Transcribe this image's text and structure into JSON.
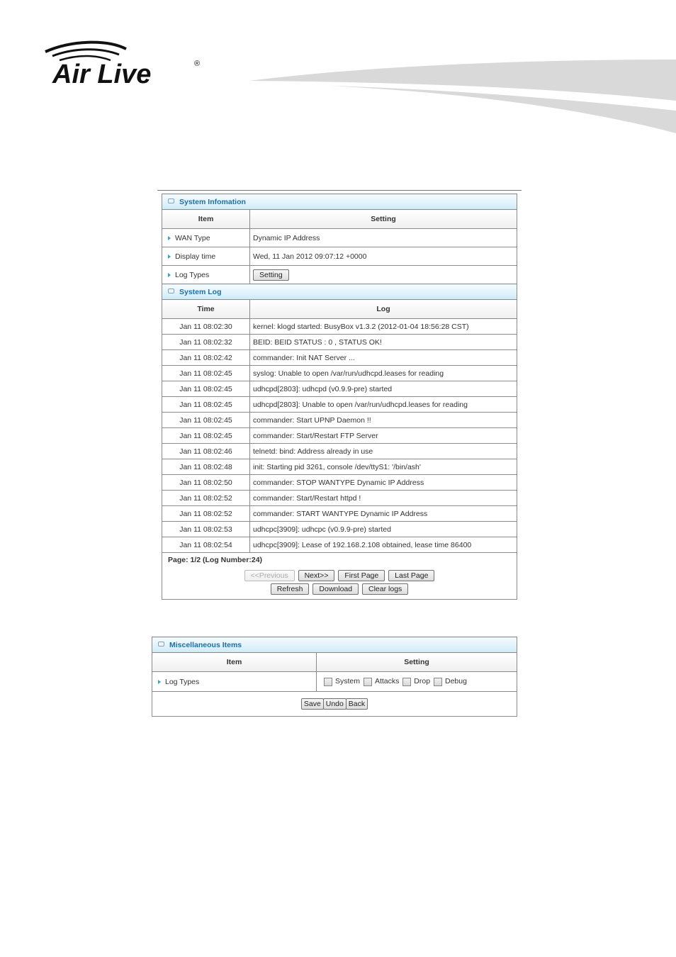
{
  "brand": {
    "name": "Air Live",
    "registered_mark": "®"
  },
  "system_info": {
    "title": "System Infomation",
    "columns": [
      "Item",
      "Setting"
    ],
    "rows": [
      {
        "label": "WAN Type",
        "value": "Dynamic IP Address"
      },
      {
        "label": "Display time",
        "value": "Wed, 11 Jan 2012 09:07:12 +0000"
      },
      {
        "label": "Log Types",
        "button": "Setting"
      }
    ]
  },
  "system_log": {
    "title": "System Log",
    "columns": [
      "Time",
      "Log"
    ],
    "rows": [
      {
        "time": "Jan 11 08:02:30",
        "log": "kernel: klogd started: BusyBox v1.3.2 (2012-01-04 18:56:28 CST)"
      },
      {
        "time": "Jan 11 08:02:32",
        "log": "BEID: BEID STATUS : 0 , STATUS OK!"
      },
      {
        "time": "Jan 11 08:02:42",
        "log": "commander: Init NAT Server ..."
      },
      {
        "time": "Jan 11 08:02:45",
        "log": "syslog: Unable to open /var/run/udhcpd.leases for reading"
      },
      {
        "time": "Jan 11 08:02:45",
        "log": "udhcpd[2803]: udhcpd (v0.9.9-pre) started"
      },
      {
        "time": "Jan 11 08:02:45",
        "log": "udhcpd[2803]: Unable to open /var/run/udhcpd.leases for reading"
      },
      {
        "time": "Jan 11 08:02:45",
        "log": "commander: Start UPNP Daemon !!"
      },
      {
        "time": "Jan 11 08:02:45",
        "log": "commander: Start/Restart FTP Server"
      },
      {
        "time": "Jan 11 08:02:46",
        "log": "telnetd: bind: Address already in use"
      },
      {
        "time": "Jan 11 08:02:48",
        "log": "init: Starting pid 3261, console /dev/ttyS1: '/bin/ash'"
      },
      {
        "time": "Jan 11 08:02:50",
        "log": "commander: STOP WANTYPE Dynamic IP Address"
      },
      {
        "time": "Jan 11 08:02:52",
        "log": "commander: Start/Restart httpd !"
      },
      {
        "time": "Jan 11 08:02:52",
        "log": "commander: START WANTYPE Dynamic IP Address"
      },
      {
        "time": "Jan 11 08:02:53",
        "log": "udhcpc[3909]: udhcpc (v0.9.9-pre) started"
      },
      {
        "time": "Jan 11 08:02:54",
        "log": "udhcpc[3909]: Lease of 192.168.2.108 obtained, lease time 86400"
      }
    ],
    "page_info": "Page: 1/2 (Log Number:24)",
    "nav_buttons": {
      "previous": "<<Previous",
      "next": "Next>>",
      "first": "First Page",
      "last": "Last Page"
    },
    "action_buttons": {
      "refresh": "Refresh",
      "download": "Download",
      "clear": "Clear logs"
    }
  },
  "misc": {
    "title": "Miscellaneous Items",
    "columns": [
      "Item",
      "Setting"
    ],
    "log_types_label": "Log Types",
    "options": [
      {
        "label": "System",
        "checked": false
      },
      {
        "label": "Attacks",
        "checked": false
      },
      {
        "label": "Drop",
        "checked": false
      },
      {
        "label": "Debug",
        "checked": false
      }
    ],
    "buttons": {
      "save": "Save",
      "undo": "Undo",
      "back": "Back"
    }
  }
}
